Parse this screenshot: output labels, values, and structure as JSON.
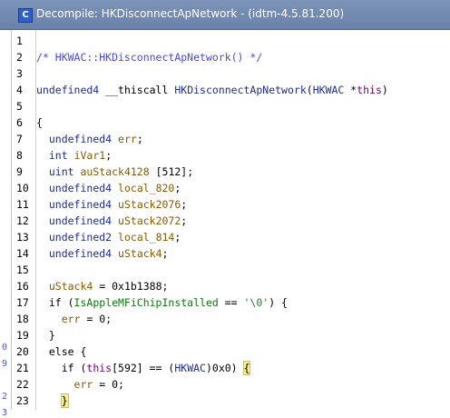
{
  "window": {
    "title": "Decompile: HKDisconnectApNetwork -  (idtm-4.5.81.200)",
    "icon": "decompile-icon",
    "icon_glyph": "C"
  },
  "left_strip_digits": [
    "0",
    "9",
    "2",
    "3"
  ],
  "colors": {
    "comment": "#4b4bd6",
    "type": "#1f2d8f",
    "variable": "#8a5a00",
    "global": "#0b7a0b",
    "param": "#7d006b",
    "highlight": "#f7f08c",
    "titlebar": "#6a82aa"
  },
  "code_lines": [
    {
      "n": "1",
      "segs": []
    },
    {
      "n": "2",
      "segs": [
        [
          "c-comment",
          "/* HKWAC::HKDisconnectApNetwork() */"
        ]
      ]
    },
    {
      "n": "3",
      "segs": []
    },
    {
      "n": "4",
      "segs": [
        [
          "c-type",
          "undefined4"
        ],
        [
          "",
          " __thiscall "
        ],
        [
          "c-func",
          "HKDisconnectApNetwork"
        ],
        [
          "",
          "("
        ],
        [
          "c-type",
          "HKWAC"
        ],
        [
          "",
          " *"
        ],
        [
          "c-param",
          "this"
        ],
        [
          "",
          ")"
        ]
      ]
    },
    {
      "n": "5",
      "segs": []
    },
    {
      "n": "6",
      "segs": [
        [
          "",
          "{"
        ]
      ]
    },
    {
      "n": "7",
      "segs": [
        [
          "",
          "  "
        ],
        [
          "c-type",
          "undefined4"
        ],
        [
          "",
          " "
        ],
        [
          "c-var",
          "err"
        ],
        [
          "",
          ";"
        ]
      ]
    },
    {
      "n": "8",
      "segs": [
        [
          "",
          "  "
        ],
        [
          "c-type",
          "int"
        ],
        [
          "",
          " "
        ],
        [
          "c-var",
          "iVar1"
        ],
        [
          "",
          ";"
        ]
      ]
    },
    {
      "n": "9",
      "segs": [
        [
          "",
          "  "
        ],
        [
          "c-type",
          "uint"
        ],
        [
          "",
          " "
        ],
        [
          "c-var",
          "auStack4128"
        ],
        [
          "",
          " [512];"
        ]
      ]
    },
    {
      "n": "10",
      "segs": [
        [
          "",
          "  "
        ],
        [
          "c-type",
          "undefined4"
        ],
        [
          "",
          " "
        ],
        [
          "c-var",
          "local_820"
        ],
        [
          "",
          ";"
        ]
      ]
    },
    {
      "n": "11",
      "segs": [
        [
          "",
          "  "
        ],
        [
          "c-type",
          "undefined4"
        ],
        [
          "",
          " "
        ],
        [
          "c-var",
          "uStack2076"
        ],
        [
          "",
          ";"
        ]
      ]
    },
    {
      "n": "12",
      "segs": [
        [
          "",
          "  "
        ],
        [
          "c-type",
          "undefined4"
        ],
        [
          "",
          " "
        ],
        [
          "c-var",
          "uStack2072"
        ],
        [
          "",
          ";"
        ]
      ]
    },
    {
      "n": "13",
      "segs": [
        [
          "",
          "  "
        ],
        [
          "c-type",
          "undefined2"
        ],
        [
          "",
          " "
        ],
        [
          "c-var",
          "local_814"
        ],
        [
          "",
          ";"
        ]
      ]
    },
    {
      "n": "14",
      "segs": [
        [
          "",
          "  "
        ],
        [
          "c-type",
          "undefined4"
        ],
        [
          "",
          " "
        ],
        [
          "c-var",
          "uStack4"
        ],
        [
          "",
          ";"
        ]
      ]
    },
    {
      "n": "15",
      "segs": []
    },
    {
      "n": "16",
      "segs": [
        [
          "",
          "  "
        ],
        [
          "c-var",
          "uStack4"
        ],
        [
          "",
          " = 0x1b1388;"
        ]
      ]
    },
    {
      "n": "17",
      "segs": [
        [
          "",
          "  if ("
        ],
        [
          "c-global",
          "IsAppleMFiChipInstalled"
        ],
        [
          "",
          " == "
        ],
        [
          "c-str",
          "'\\0'"
        ],
        [
          "",
          ") {"
        ]
      ]
    },
    {
      "n": "18",
      "segs": [
        [
          "",
          "    "
        ],
        [
          "c-var",
          "err"
        ],
        [
          "",
          " = 0;"
        ]
      ]
    },
    {
      "n": "19",
      "segs": [
        [
          "",
          "  }"
        ]
      ]
    },
    {
      "n": "20",
      "segs": [
        [
          "",
          "  else {"
        ]
      ]
    },
    {
      "n": "21",
      "segs": [
        [
          "",
          "    if ("
        ],
        [
          "c-param",
          "this"
        ],
        [
          "",
          "[592] == ("
        ],
        [
          "c-type",
          "HKWAC"
        ],
        [
          "",
          ")0x0) "
        ],
        [
          "brace-hl",
          "{"
        ]
      ]
    },
    {
      "n": "22",
      "segs": [
        [
          "",
          "      "
        ],
        [
          "c-var",
          "err"
        ],
        [
          "",
          " = 0;"
        ]
      ]
    },
    {
      "n": "23",
      "segs": [
        [
          "",
          "    "
        ],
        [
          "brace-hl",
          "}"
        ]
      ]
    }
  ]
}
